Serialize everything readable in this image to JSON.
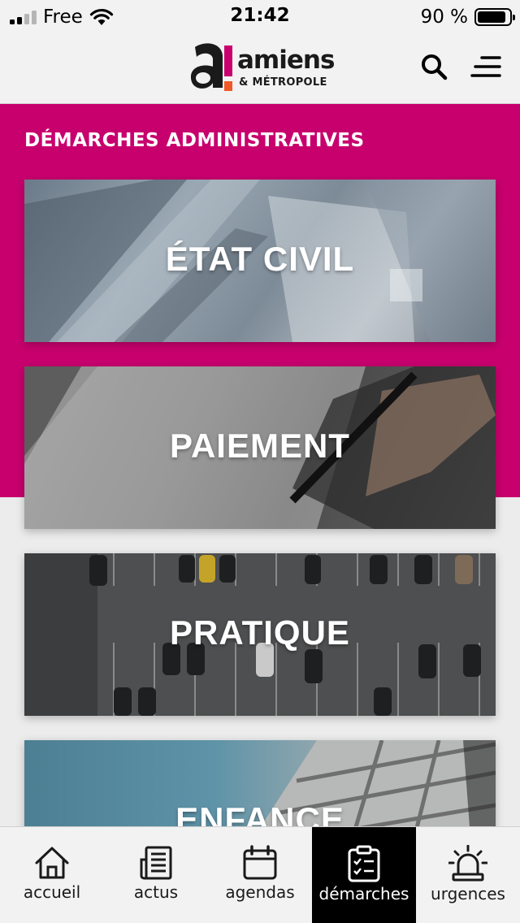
{
  "status_bar": {
    "carrier": "Free",
    "time": "21:42",
    "battery": "90 %",
    "battery_level": 0.9
  },
  "header": {
    "logo_word": "amiens",
    "logo_sub": "& MÉTROPOLE",
    "brand_color": "#c8006e",
    "logo_accent": "#f05a28"
  },
  "section": {
    "title": "DÉMARCHES ADMINISTRATIVES"
  },
  "cards": [
    {
      "label": "ÉTAT CIVIL"
    },
    {
      "label": "PAIEMENT"
    },
    {
      "label": "PRATIQUE"
    },
    {
      "label": "ENFANCE"
    }
  ],
  "tabs": [
    {
      "label": "accueil",
      "icon": "home-icon"
    },
    {
      "label": "actus",
      "icon": "news-icon"
    },
    {
      "label": "agendas",
      "icon": "calendar-icon"
    },
    {
      "label": "démarches",
      "icon": "clipboard-checklist-icon",
      "active": true
    },
    {
      "label": "urgences",
      "icon": "alarm-siren-icon"
    }
  ]
}
